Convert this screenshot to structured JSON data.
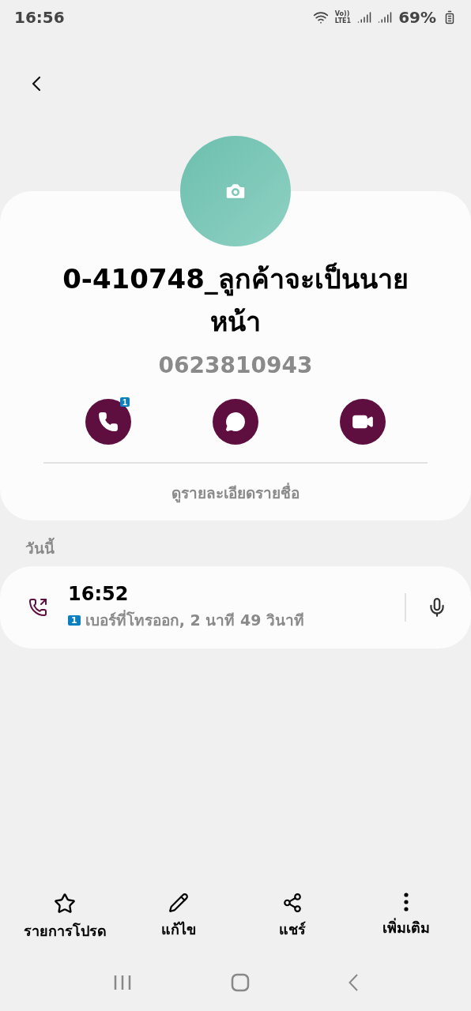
{
  "status_bar": {
    "time": "16:56",
    "battery": "69%",
    "network_label": "Vo))\nLTE1"
  },
  "contact": {
    "name": "0-410748_ลูกค้าจะเป็นนายหน้า",
    "phone": "0623810943",
    "actions": [
      {
        "kind": "call",
        "badge": "1"
      },
      {
        "kind": "message"
      },
      {
        "kind": "video"
      }
    ],
    "details_link": "ดูรายละเอียดรายชื่อ"
  },
  "history": {
    "heading": "วันนี้",
    "entries": [
      {
        "time": "16:52",
        "sim": "1",
        "description": "เบอร์ที่โทรออก, 2 นาที 49 วินาที"
      }
    ]
  },
  "bottom_actions": [
    {
      "kind": "favorite",
      "label": "รายการโปรด"
    },
    {
      "kind": "edit",
      "label": "แก้ไข"
    },
    {
      "kind": "share",
      "label": "แชร์"
    },
    {
      "kind": "more",
      "label": "เพิ่มเติม"
    }
  ]
}
